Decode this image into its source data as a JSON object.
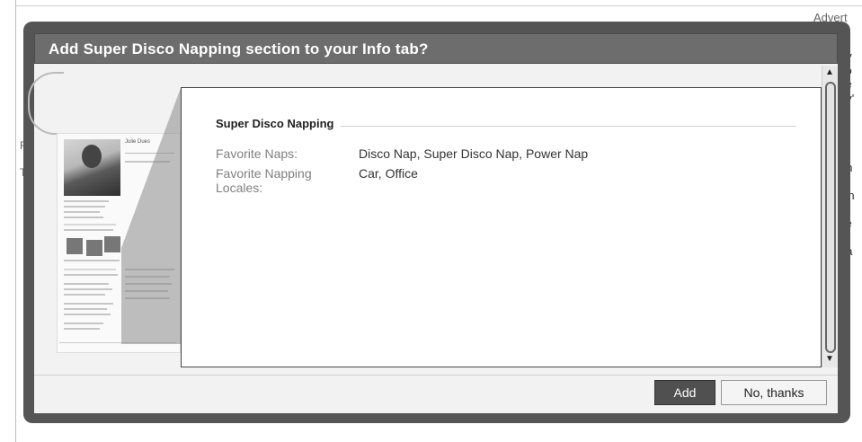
{
  "dialog": {
    "title": "Add Super Disco Napping section to your Info tab?",
    "add_label": "Add",
    "decline_label": "No, thanks"
  },
  "card": {
    "section_title": "Super Disco Napping",
    "fields": [
      {
        "label": "Favorite Naps:",
        "value": "Disco Nap, Super Disco Nap, Power Nap"
      },
      {
        "label": "Favorite Napping Locales:",
        "value": "Car, Office"
      }
    ]
  },
  "preview": {
    "profile_name": "Julie Dues"
  },
  "background": {
    "advert": "Advert",
    "right_fragments": [
      "py",
      "yo",
      "ce",
      "oy'",
      "C",
      "st",
      "nt",
      "",
      "on",
      "",
      "kin",
      "nt",
      "ce",
      "to",
      "t a",
      "b",
      "",
      "",
      "",
      "A"
    ],
    "left_fragments": [
      "FI",
      "TI"
    ]
  }
}
